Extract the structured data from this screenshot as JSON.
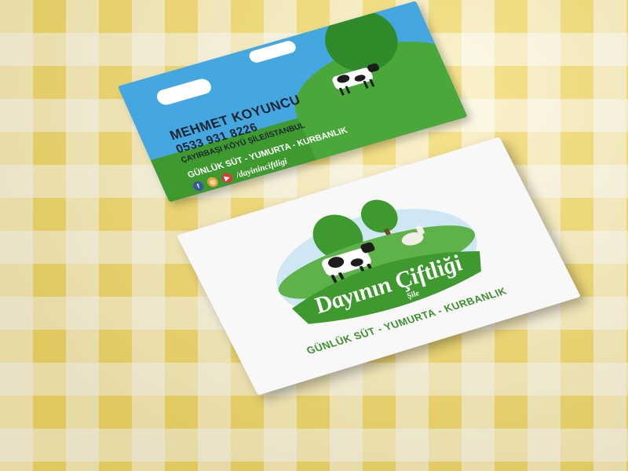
{
  "back_card": {
    "name": "MEHMET KOYUNCU",
    "phone": "0533 931 8226",
    "address": "ÇAYIRBAŞI KÖYÜ ŞİLE/İSTANBUL",
    "services": "GÜNLÜK SÜT - YUMURTA - KURBANLIK",
    "social_handle": "/dayininciftligi",
    "social_icons": [
      {
        "icon": "facebook-icon",
        "glyph": "f",
        "color": "#3b5998"
      },
      {
        "icon": "instagram-icon",
        "glyph": "◎",
        "color": "#e8a53c"
      },
      {
        "icon": "youtube-icon",
        "glyph": "▶",
        "color": "#d63b3b"
      }
    ],
    "colors": {
      "sky": "#44a7e0",
      "grass": "#3e9a2e",
      "text": "#1a2433"
    }
  },
  "front_card": {
    "logo_title": "Dayının Çiftliği",
    "logo_subtitle": "Şile",
    "services": "GÜNLÜK SÜT - YUMURTA - KURBANLIK",
    "colors": {
      "green": "#3c8f2c",
      "background": "#f7f8f7"
    }
  },
  "tablecloth": {
    "pattern": "yellow-white gingham",
    "color": "#f2d968"
  }
}
